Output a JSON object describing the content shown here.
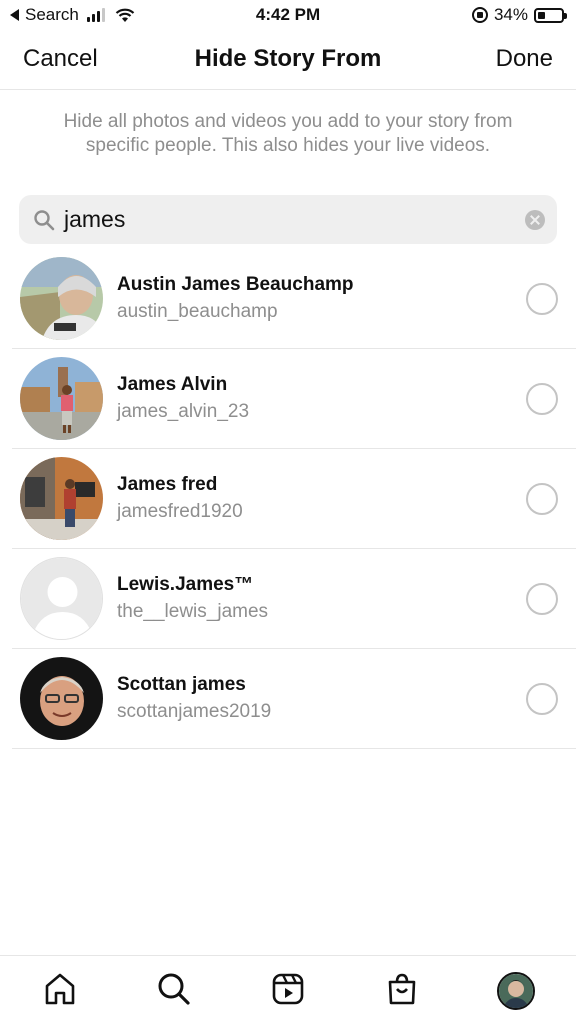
{
  "status_bar": {
    "back_label": "Search",
    "time": "4:42 PM",
    "battery": "34%",
    "battery_level": 0.34
  },
  "header": {
    "cancel_label": "Cancel",
    "title": "Hide Story From",
    "done_label": "Done"
  },
  "description": "Hide all photos and videos you add to your story from specific people. This also hides your live videos.",
  "search": {
    "value": "james"
  },
  "users": [
    {
      "name": "Austin James Beauchamp",
      "handle": "austin_beauchamp",
      "selected": false
    },
    {
      "name": "James Alvin",
      "handle": "james_alvin_23",
      "selected": false
    },
    {
      "name": "James fred",
      "handle": "jamesfred1920",
      "selected": false
    },
    {
      "name": "Lewis.James™",
      "handle": "the__lewis_james",
      "selected": false
    },
    {
      "name": "Scottan james",
      "handle": "scottanjames2019",
      "selected": false
    }
  ],
  "tab_bar": {
    "tabs": [
      "home-icon",
      "search-icon",
      "reels-icon",
      "shop-icon",
      "profile-avatar"
    ]
  },
  "colors": {
    "secondary_text": "#8e8e8e",
    "divider": "#e6e6e6",
    "search_bg": "#efefef"
  }
}
